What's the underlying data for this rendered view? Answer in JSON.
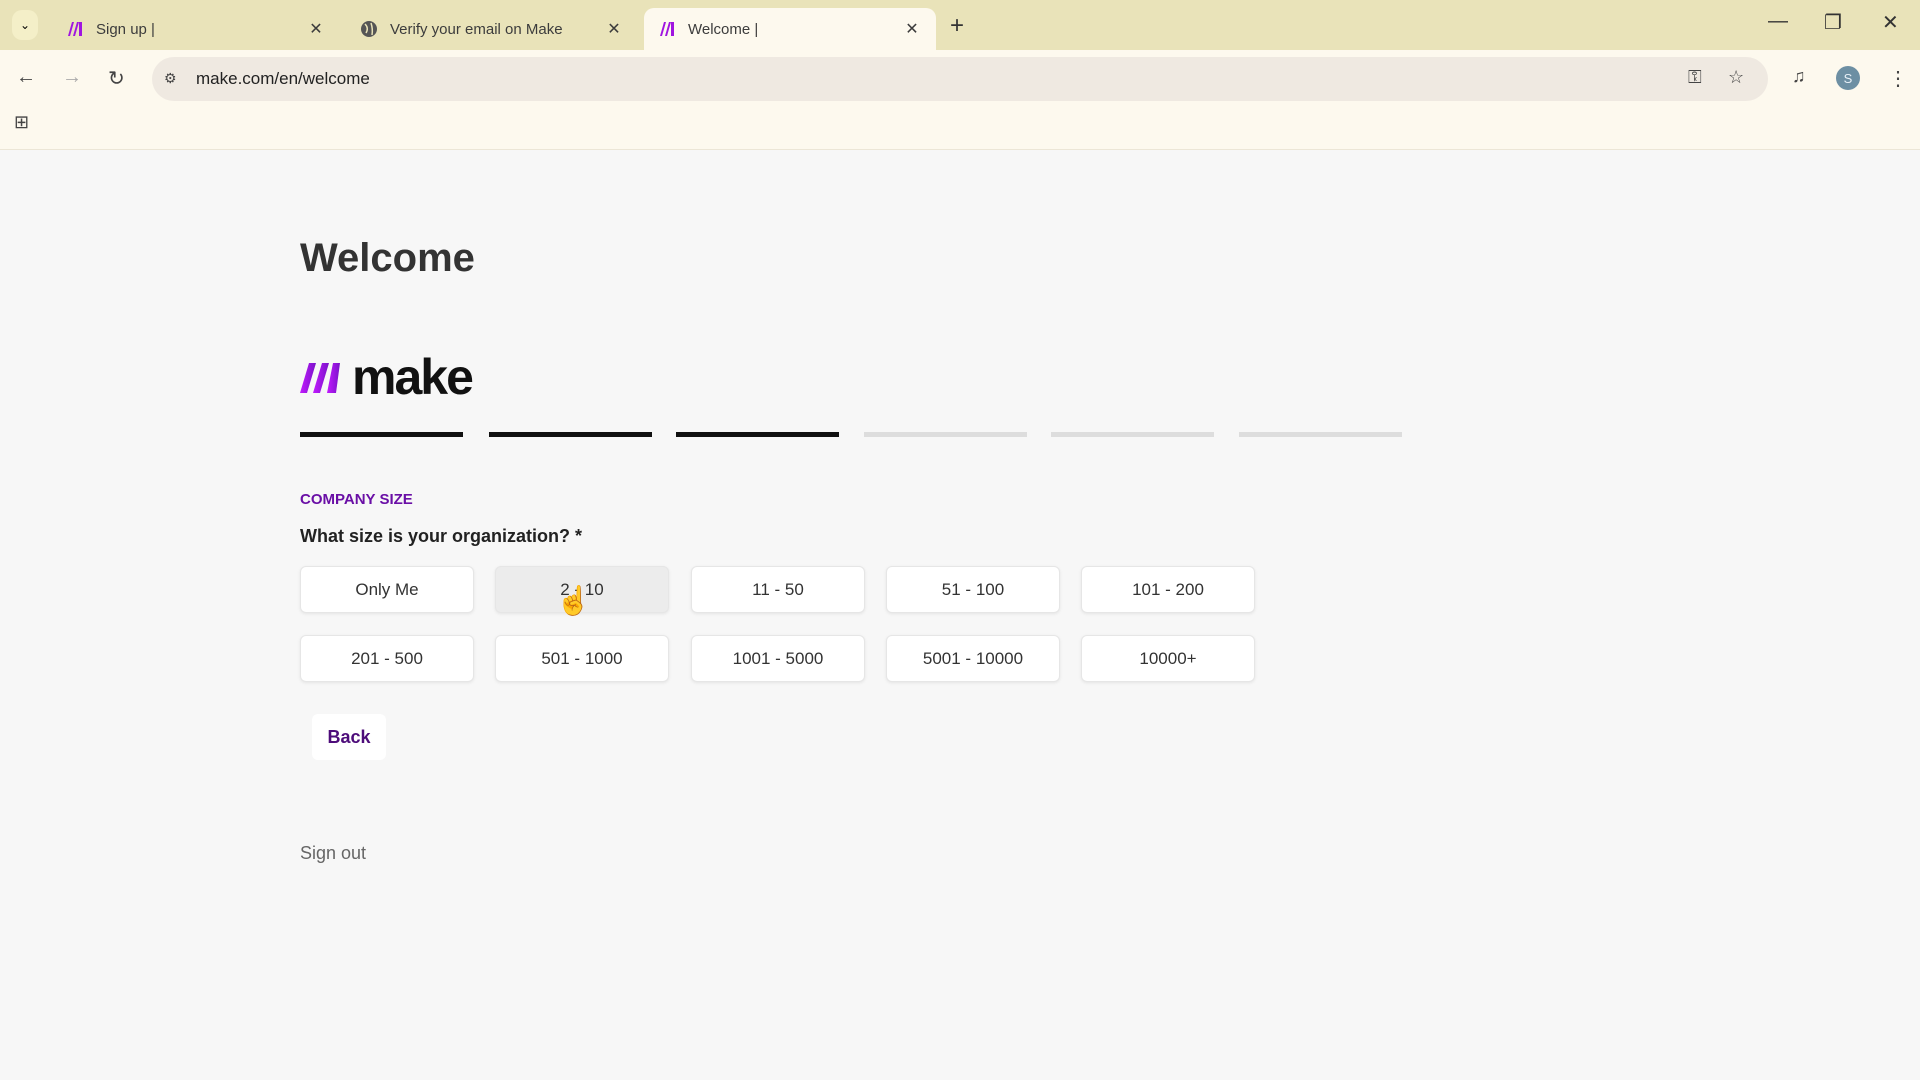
{
  "browser": {
    "tabs": [
      {
        "title": "Sign up |",
        "icon": "make-logo-icon"
      },
      {
        "title": "Verify your email on Make",
        "icon": "globe-icon"
      },
      {
        "title": "Welcome |",
        "icon": "make-logo-icon",
        "active": true
      }
    ],
    "url": "make.com/en/welcome",
    "profile_initial": "S"
  },
  "page": {
    "title": "Welcome",
    "logo_text": "make",
    "progress": {
      "total_steps": 6,
      "completed_steps": 3
    },
    "section_label": "COMPANY SIZE",
    "question": "What size is your organization? *",
    "options": [
      "Only Me",
      "2 - 10",
      "11 - 50",
      "51 - 100",
      "101 - 200",
      "201 - 500",
      "501 - 1000",
      "1001 - 5000",
      "5001 - 10000",
      "10000+"
    ],
    "back_label": "Back",
    "sign_out_label": "Sign out"
  },
  "colors": {
    "accent": "#6a0fa6",
    "logo_gradient_start": "#c21bff",
    "logo_gradient_end": "#7a12c9"
  }
}
